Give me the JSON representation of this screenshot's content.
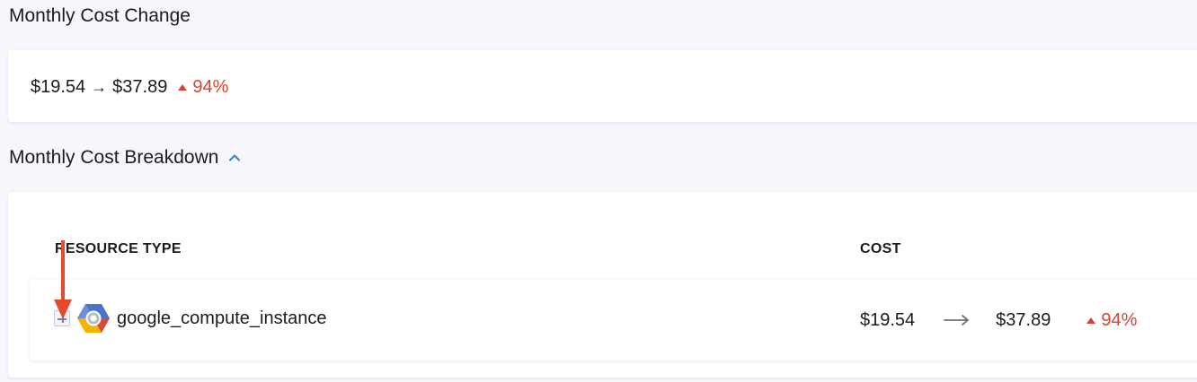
{
  "summary": {
    "title": "Monthly Cost Change",
    "from_cost": "$19.54",
    "arrow": "→",
    "to_cost": "$37.89",
    "change_pct": "94%"
  },
  "breakdown": {
    "title": "Monthly Cost Breakdown",
    "columns": {
      "resource_type": "RESOURCE TYPE",
      "cost": "COST"
    },
    "rows": [
      {
        "resource": "google_compute_instance",
        "icon": "google-compute-engine-icon",
        "from_cost": "$19.54",
        "to_cost": "$37.89",
        "change_pct": "94%"
      }
    ]
  },
  "colors": {
    "increase": "#d8432f",
    "accent": "#3b7ad9",
    "annotation_arrow": "#e64a2e"
  }
}
